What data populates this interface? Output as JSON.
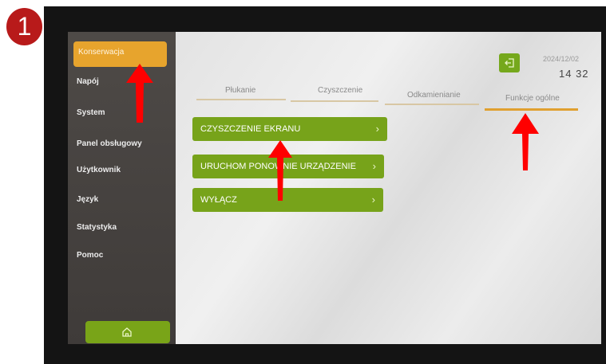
{
  "step_badge": "1",
  "sidebar": {
    "items": [
      {
        "label": "Konserwacja",
        "active": true
      },
      {
        "label": "Napój"
      },
      {
        "label": "System"
      },
      {
        "label": "Panel obsługowy"
      },
      {
        "label": "Użytkownik"
      },
      {
        "label": "Język"
      },
      {
        "label": "Statystyka"
      },
      {
        "label": "Pomoc"
      }
    ],
    "home_icon": "home-icon"
  },
  "header": {
    "exit_icon": "exit-icon",
    "date": "2024/12/02",
    "time": "14 32"
  },
  "tabs": [
    {
      "label": "Płukanie"
    },
    {
      "label": "Czyszczenie"
    },
    {
      "label": "Odkamienianie"
    },
    {
      "label": "Funkcje ogólne",
      "active": true
    }
  ],
  "actions": [
    {
      "label": "CZYSZCZENIE EKRANU"
    },
    {
      "label": "URUCHOM PONOWNIE URZĄDZENIE"
    },
    {
      "label": "WYŁĄCZ"
    }
  ],
  "colors": {
    "accent_orange": "#e7a42d",
    "accent_green": "#77a31a",
    "badge_red": "#b81a1a",
    "arrow_red": "#ff0000"
  }
}
